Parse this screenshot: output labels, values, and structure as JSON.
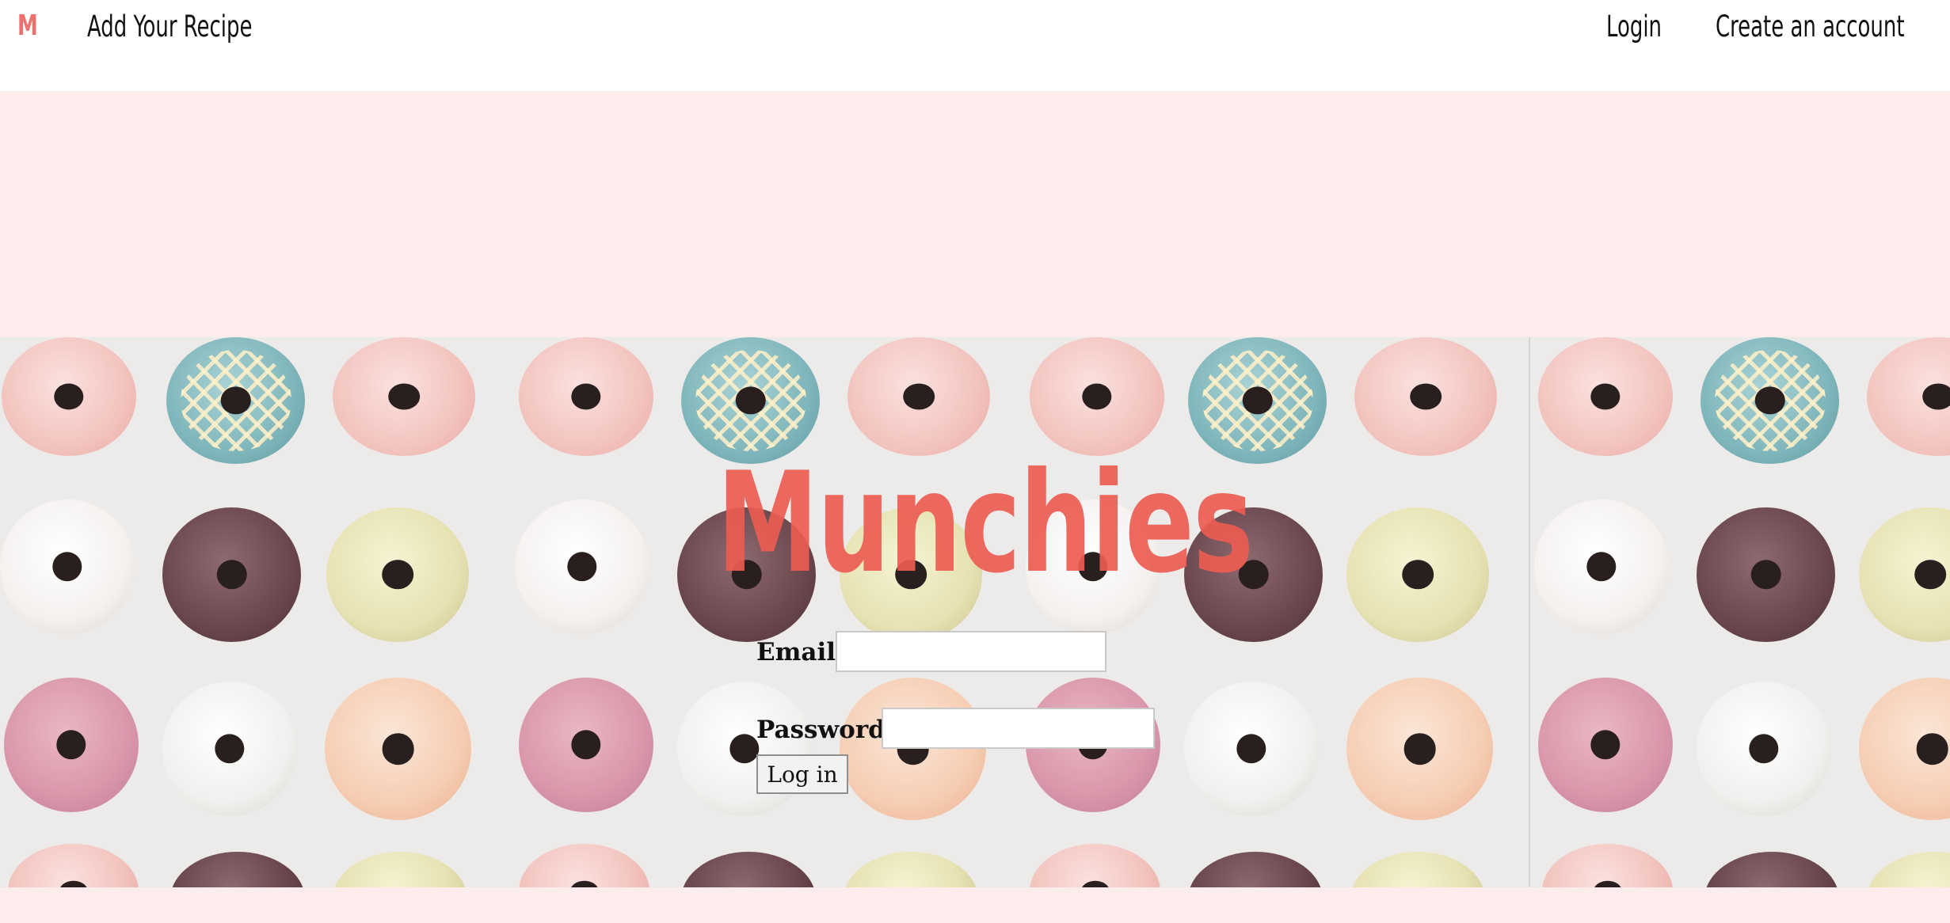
{
  "navbar": {
    "logo": "M",
    "add_recipe": "Add Your Recipe",
    "login": "Login",
    "create_account": "Create an account"
  },
  "hero": {
    "title": "Munchies"
  },
  "login_form": {
    "email_label": "Email",
    "email_value": "",
    "password_label": "Password",
    "password_value": "",
    "submit_label": "Log in"
  },
  "colors": {
    "brand": "#ee6f6c",
    "page_background": "#fdecec",
    "navbar_background": "#ffffff"
  }
}
